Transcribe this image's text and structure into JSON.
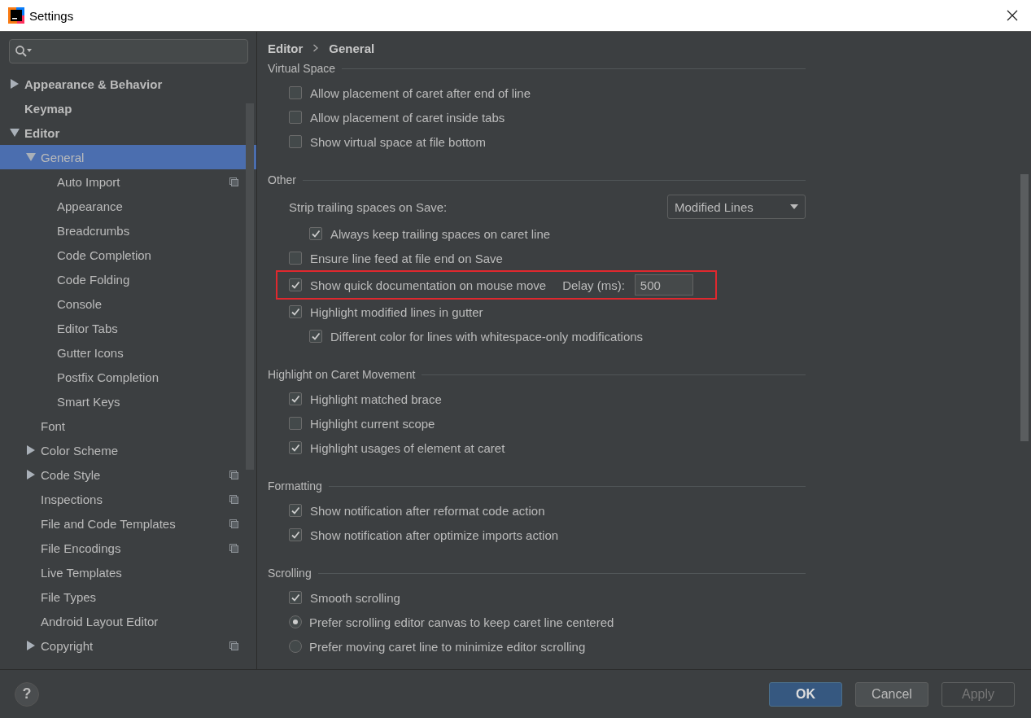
{
  "window": {
    "title": "Settings"
  },
  "sidebar": {
    "items": [
      {
        "label": "Appearance & Behavior",
        "expanded": false,
        "selected": false,
        "project_level": false
      },
      {
        "label": "Keymap",
        "selected": false,
        "project_level": false
      },
      {
        "label": "Editor",
        "expanded": true,
        "selected": false,
        "project_level": false,
        "children": [
          {
            "label": "General",
            "expanded": true,
            "selected": true,
            "project_level": false,
            "children": [
              {
                "label": "Auto Import",
                "selected": false,
                "project_level": true
              },
              {
                "label": "Appearance",
                "selected": false,
                "project_level": false
              },
              {
                "label": "Breadcrumbs",
                "selected": false,
                "project_level": false
              },
              {
                "label": "Code Completion",
                "selected": false,
                "project_level": false
              },
              {
                "label": "Code Folding",
                "selected": false,
                "project_level": false
              },
              {
                "label": "Console",
                "selected": false,
                "project_level": false
              },
              {
                "label": "Editor Tabs",
                "selected": false,
                "project_level": false
              },
              {
                "label": "Gutter Icons",
                "selected": false,
                "project_level": false
              },
              {
                "label": "Postfix Completion",
                "selected": false,
                "project_level": false
              },
              {
                "label": "Smart Keys",
                "selected": false,
                "project_level": false
              }
            ]
          },
          {
            "label": "Font",
            "selected": false,
            "project_level": false
          },
          {
            "label": "Color Scheme",
            "expanded": false,
            "selected": false,
            "project_level": false
          },
          {
            "label": "Code Style",
            "expanded": false,
            "selected": false,
            "project_level": true
          },
          {
            "label": "Inspections",
            "selected": false,
            "project_level": true
          },
          {
            "label": "File and Code Templates",
            "selected": false,
            "project_level": true
          },
          {
            "label": "File Encodings",
            "selected": false,
            "project_level": true
          },
          {
            "label": "Live Templates",
            "selected": false,
            "project_level": false
          },
          {
            "label": "File Types",
            "selected": false,
            "project_level": false
          },
          {
            "label": "Android Layout Editor",
            "selected": false,
            "project_level": false
          },
          {
            "label": "Copyright",
            "expanded": false,
            "selected": false,
            "project_level": true
          }
        ]
      }
    ]
  },
  "breadcrumb": [
    "Editor",
    "General"
  ],
  "sections": [
    {
      "title": "Virtual Space",
      "items": [
        {
          "kind": "checkbox",
          "label": "Allow placement of caret after end of line",
          "checked": false
        },
        {
          "kind": "checkbox",
          "label": "Allow placement of caret inside tabs",
          "checked": false
        },
        {
          "kind": "checkbox",
          "label": "Show virtual space at file bottom",
          "checked": false
        }
      ]
    },
    {
      "title": "Other",
      "items": [
        {
          "kind": "dropdown",
          "label": "Strip trailing spaces on Save:",
          "value": "Modified Lines",
          "children": [
            {
              "kind": "checkbox",
              "label": "Always keep trailing spaces on caret line",
              "checked": true
            }
          ]
        },
        {
          "kind": "checkbox",
          "label": "Ensure line feed at file end on Save",
          "checked": false
        },
        {
          "kind": "checkbox",
          "label": "Show quick documentation on mouse move",
          "checked": true,
          "highlighted": true,
          "field": {
            "label": "Delay (ms):",
            "value": "500"
          }
        },
        {
          "kind": "checkbox",
          "label": "Highlight modified lines in gutter",
          "checked": true,
          "children": [
            {
              "kind": "checkbox",
              "label": "Different color for lines with whitespace-only modifications",
              "checked": true
            }
          ]
        }
      ]
    },
    {
      "title": "Highlight on Caret Movement",
      "items": [
        {
          "kind": "checkbox",
          "label": "Highlight matched brace",
          "checked": true
        },
        {
          "kind": "checkbox",
          "label": "Highlight current scope",
          "checked": false
        },
        {
          "kind": "checkbox",
          "label": "Highlight usages of element at caret",
          "checked": true
        }
      ]
    },
    {
      "title": "Formatting",
      "items": [
        {
          "kind": "checkbox",
          "label": "Show notification after reformat code action",
          "checked": true
        },
        {
          "kind": "checkbox",
          "label": "Show notification after optimize imports action",
          "checked": true
        }
      ]
    },
    {
      "title": "Scrolling",
      "items": [
        {
          "kind": "checkbox",
          "label": "Smooth scrolling",
          "checked": true
        },
        {
          "kind": "radio",
          "label": "Prefer scrolling editor canvas to keep caret line centered",
          "selected": true
        },
        {
          "kind": "radio",
          "label": "Prefer moving caret line to minimize editor scrolling",
          "selected": false
        }
      ]
    }
  ],
  "footer": {
    "help": "?",
    "buttons": [
      {
        "label": "OK",
        "default": true,
        "disabled": false
      },
      {
        "label": "Cancel",
        "default": false,
        "disabled": false
      },
      {
        "label": "Apply",
        "default": false,
        "disabled": true
      }
    ]
  }
}
